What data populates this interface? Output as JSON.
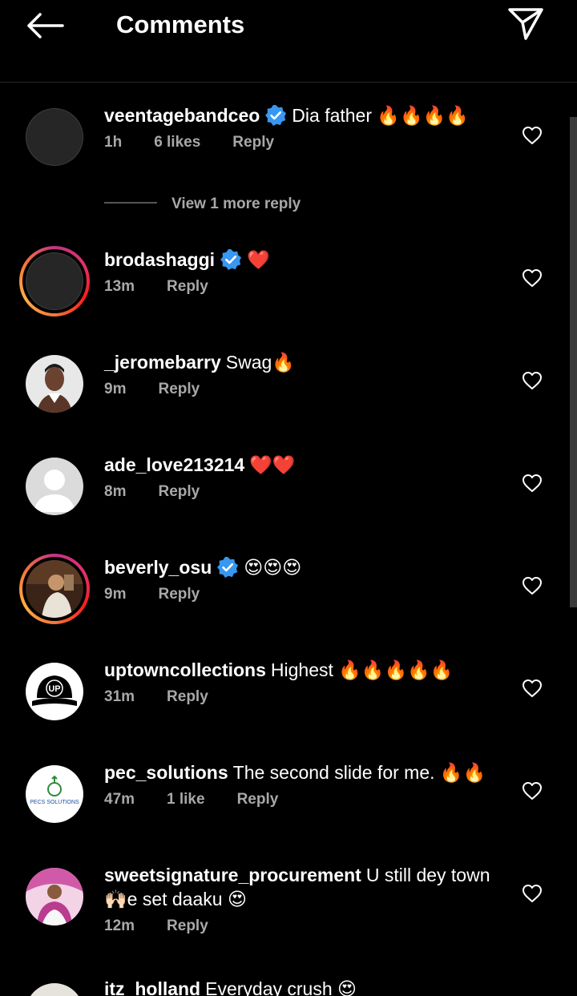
{
  "header": {
    "title": "Comments",
    "back_icon": "arrow-left-icon",
    "send_icon": "paper-plane-icon"
  },
  "comments": [
    {
      "username": "veentagebandceo",
      "verified": true,
      "text": "Dia father 🔥🔥🔥🔥",
      "time": "1h",
      "likes": "6 likes",
      "reply": "Reply",
      "avatar": "dark"
    },
    {
      "username": "brodashaggi",
      "verified": true,
      "text": "❤️",
      "time": "13m",
      "likes": "",
      "reply": "Reply",
      "avatar": "story-ring"
    },
    {
      "username": "_jeromebarry",
      "verified": false,
      "text": "Swag🔥",
      "time": "9m",
      "likes": "",
      "reply": "Reply",
      "avatar": "photo"
    },
    {
      "username": "ade_love213214",
      "verified": false,
      "text": "❤️❤️",
      "time": "8m",
      "likes": "",
      "reply": "Reply",
      "avatar": "default"
    },
    {
      "username": "beverly_osu",
      "verified": true,
      "text": "😍😍😍",
      "time": "9m",
      "likes": "",
      "reply": "Reply",
      "avatar": "story-ring-photo"
    },
    {
      "username": "uptowncollections",
      "verified": false,
      "text": "Highest 🔥🔥🔥🔥🔥",
      "time": "31m",
      "likes": "",
      "reply": "Reply",
      "avatar": "up-logo"
    },
    {
      "username": "pec_solutions",
      "verified": false,
      "text": "The second slide for me. 🔥🔥",
      "time": "47m",
      "likes": "1 like",
      "reply": "Reply",
      "avatar": "pecs-logo"
    },
    {
      "username": "sweetsignature_procurement",
      "verified": false,
      "text": "U still dey town 🙌🏻e set daaku 😍",
      "time": "12m",
      "likes": "",
      "reply": "Reply",
      "avatar": "photo-pink"
    },
    {
      "username": "itz_holland",
      "verified": false,
      "text": "Everyday crush 😍",
      "time": "",
      "likes": "",
      "reply": "",
      "avatar": "photo"
    }
  ],
  "view_more_replies": "View 1 more reply",
  "logos": {
    "up": "UP",
    "pecs": "PECS SOLUTIONS"
  }
}
